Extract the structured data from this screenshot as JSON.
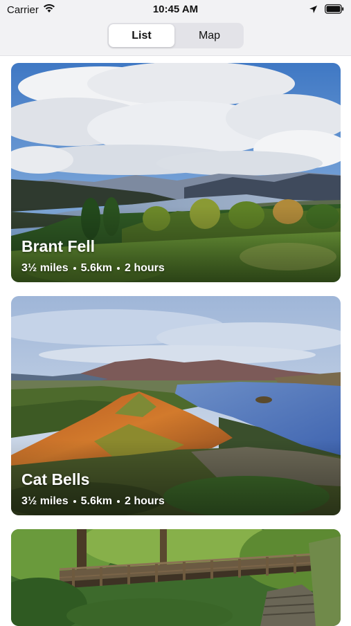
{
  "status_bar": {
    "carrier": "Carrier",
    "time": "10:45 AM",
    "icons": [
      "wifi-icon",
      "location-icon",
      "battery-icon"
    ]
  },
  "segmented_control": {
    "options": [
      {
        "label": "List",
        "selected": true
      },
      {
        "label": "Map",
        "selected": false
      }
    ]
  },
  "walks": [
    {
      "name": "Brant Fell",
      "distance_miles": "3½ miles",
      "distance_km": "5.6km",
      "duration": "2 hours"
    },
    {
      "name": "Cat Bells",
      "distance_miles": "3½ miles",
      "distance_km": "5.6km",
      "duration": "2 hours"
    }
  ]
}
